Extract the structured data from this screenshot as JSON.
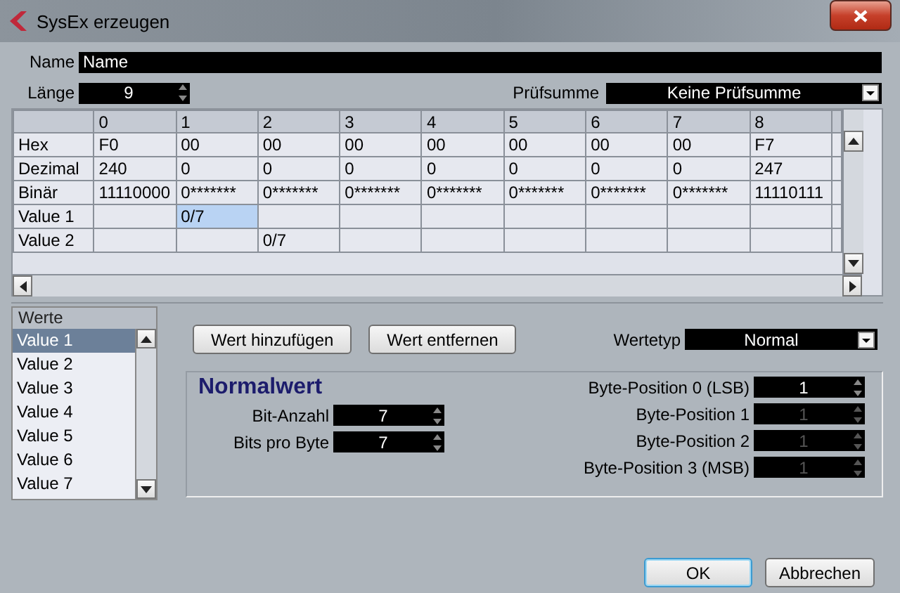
{
  "window": {
    "title": "SysEx erzeugen"
  },
  "name_field": {
    "label": "Name",
    "value": "Name"
  },
  "length_field": {
    "label": "Länge",
    "value": "9"
  },
  "checksum": {
    "label": "Prüfsumme",
    "value": "Keine Prüfsumme"
  },
  "table": {
    "columns": [
      "0",
      "1",
      "2",
      "3",
      "4",
      "5",
      "6",
      "7",
      "8"
    ],
    "rows": [
      {
        "label": "Hex",
        "cells": [
          {
            "text": "F0",
            "selected": false
          },
          {
            "text": "00",
            "selected": false
          },
          {
            "text": "00",
            "selected": false
          },
          {
            "text": "00",
            "selected": false
          },
          {
            "text": "00",
            "selected": false
          },
          {
            "text": "00",
            "selected": false
          },
          {
            "text": "00",
            "selected": false
          },
          {
            "text": "00",
            "selected": false
          },
          {
            "text": "F7",
            "selected": false
          }
        ]
      },
      {
        "label": "Dezimal",
        "cells": [
          {
            "text": "240",
            "selected": false
          },
          {
            "text": "0",
            "selected": false
          },
          {
            "text": "0",
            "selected": false
          },
          {
            "text": "0",
            "selected": false
          },
          {
            "text": "0",
            "selected": false
          },
          {
            "text": "0",
            "selected": false
          },
          {
            "text": "0",
            "selected": false
          },
          {
            "text": "0",
            "selected": false
          },
          {
            "text": "247",
            "selected": false
          }
        ]
      },
      {
        "label": "Binär",
        "cells": [
          {
            "text": "11110000",
            "selected": false
          },
          {
            "text": "0*******",
            "selected": false
          },
          {
            "text": "0*******",
            "selected": false
          },
          {
            "text": "0*******",
            "selected": false
          },
          {
            "text": "0*******",
            "selected": false
          },
          {
            "text": "0*******",
            "selected": false
          },
          {
            "text": "0*******",
            "selected": false
          },
          {
            "text": "0*******",
            "selected": false
          },
          {
            "text": "11110111",
            "selected": false
          }
        ]
      },
      {
        "label": "Value 1",
        "cells": [
          {
            "selected": false
          },
          {
            "text": "0/7",
            "selected": true
          },
          {
            "selected": false
          },
          {
            "selected": false
          },
          {
            "selected": false
          },
          {
            "selected": false
          },
          {
            "selected": false
          },
          {
            "selected": false
          },
          {
            "selected": false
          }
        ]
      },
      {
        "label": "Value 2",
        "cells": [
          {
            "selected": false
          },
          {
            "selected": false
          },
          {
            "text": "0/7",
            "selected": false
          },
          {
            "selected": false
          },
          {
            "selected": false
          },
          {
            "selected": false
          },
          {
            "selected": false
          },
          {
            "selected": false
          },
          {
            "selected": false
          }
        ]
      }
    ]
  },
  "values_list": {
    "title": "Werte",
    "items": [
      {
        "label": "Value 1",
        "selected": true
      },
      {
        "label": "Value 2",
        "selected": false
      },
      {
        "label": "Value 3",
        "selected": false
      },
      {
        "label": "Value 4",
        "selected": false
      },
      {
        "label": "Value 5",
        "selected": false
      },
      {
        "label": "Value 6",
        "selected": false
      },
      {
        "label": "Value 7",
        "selected": false
      }
    ]
  },
  "value_buttons": [
    "Wert hinzufügen",
    "Wert entfernen"
  ],
  "value_type": {
    "label": "Wertetyp",
    "value": "Normal"
  },
  "panel": {
    "title": "Normalwert",
    "left_fields": [
      {
        "label": "Bit-Anzahl",
        "value": "7",
        "disabled": false
      },
      {
        "label": "Bits pro Byte",
        "value": "7",
        "disabled": false
      }
    ],
    "right_fields": [
      {
        "label": "Byte-Position 0 (LSB)",
        "value": "1",
        "disabled": false
      },
      {
        "label": "Byte-Position 1",
        "value": "1",
        "disabled": true
      },
      {
        "label": "Byte-Position 2",
        "value": "1",
        "disabled": true
      },
      {
        "label": "Byte-Position 3 (MSB)",
        "value": "1",
        "disabled": true
      }
    ]
  },
  "footer_buttons": [
    {
      "label": "OK",
      "default": true
    },
    {
      "label": "Abbrechen",
      "default": false
    }
  ]
}
